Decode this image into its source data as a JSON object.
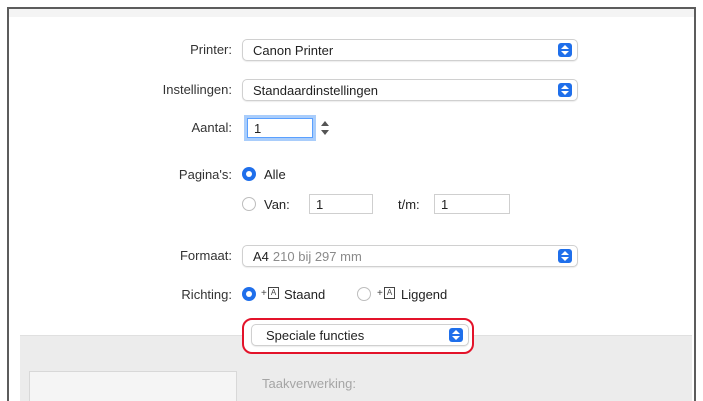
{
  "printer": {
    "label": "Printer:",
    "value": "Canon Printer"
  },
  "instellingen": {
    "label": "Instellingen:",
    "value": "Standaardinstellingen"
  },
  "aantal": {
    "label": "Aantal:",
    "value": "1"
  },
  "paginas": {
    "label": "Pagina's:",
    "alle_label": "Alle",
    "van_label": "Van:",
    "van_value": "1",
    "tm_label": "t/m:",
    "tm_value": "1",
    "selected": "Alle"
  },
  "formaat": {
    "label": "Formaat:",
    "value": "A4",
    "detail": "210 bij 297 mm"
  },
  "richting": {
    "label": "Richting:",
    "staand_label": "Staand",
    "liggend_label": "Liggend",
    "selected": "Staand"
  },
  "panel_select": {
    "value": "Speciale functies"
  },
  "section": {
    "taakverwerking_label": "Taakverwerking:"
  },
  "colors": {
    "accent": "#1f6feb",
    "highlight": "#e3132a",
    "focus_ring": "#a9cdfb"
  },
  "icons": [
    "stepper-arrows-icon",
    "portrait-orientation-icon",
    "landscape-orientation-icon",
    "popup-chevrons-icon"
  ]
}
